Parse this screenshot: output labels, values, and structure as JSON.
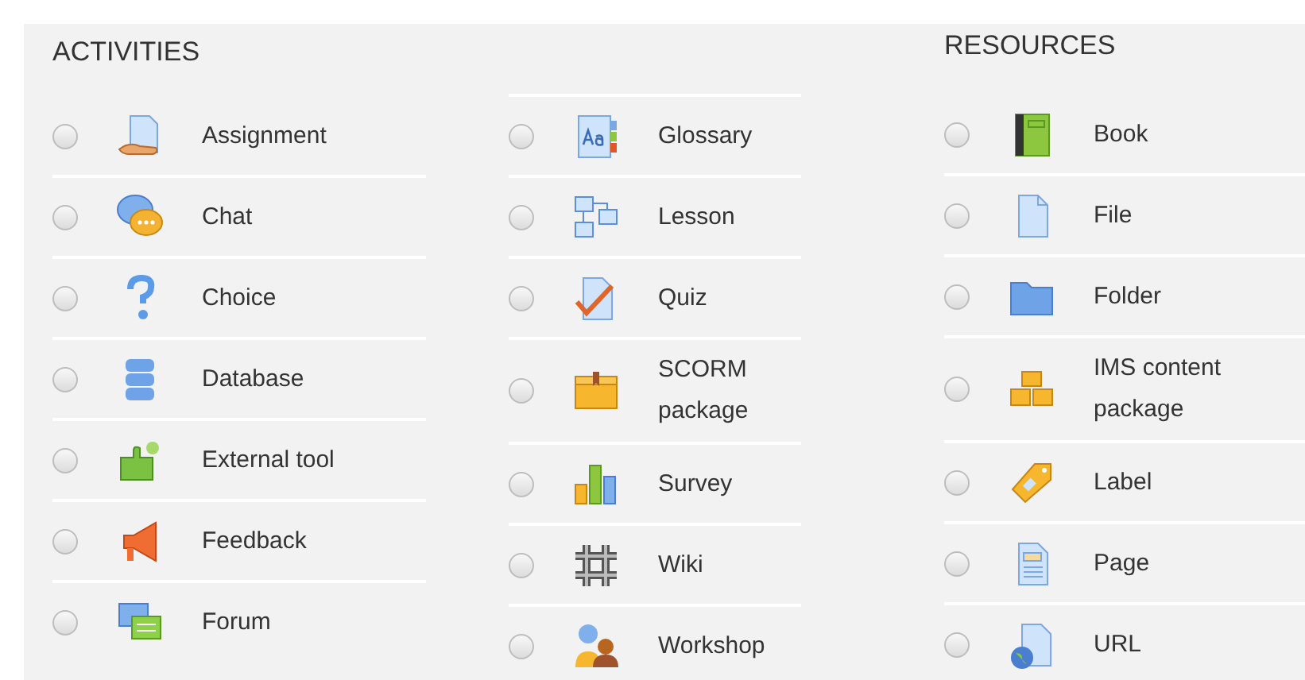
{
  "activities": {
    "heading": "ACTIVITIES",
    "columns": [
      [
        {
          "label": "Assignment",
          "selected": false
        },
        {
          "label": "Chat",
          "selected": false
        },
        {
          "label": "Choice",
          "selected": false
        },
        {
          "label": "Database",
          "selected": false
        },
        {
          "label": "External tool",
          "selected": false
        },
        {
          "label": "Feedback",
          "selected": false
        },
        {
          "label": "Forum",
          "selected": false
        }
      ],
      [
        {
          "label": "Glossary",
          "selected": false
        },
        {
          "label": "Lesson",
          "selected": false
        },
        {
          "label": "Quiz",
          "selected": false
        },
        {
          "label": "SCORM package",
          "selected": false
        },
        {
          "label": "Survey",
          "selected": false
        },
        {
          "label": "Wiki",
          "selected": false
        },
        {
          "label": "Workshop",
          "selected": false
        }
      ]
    ]
  },
  "resources": {
    "heading": "RESOURCES",
    "items": [
      {
        "label": "Book",
        "selected": false
      },
      {
        "label": "File",
        "selected": false
      },
      {
        "label": "Folder",
        "selected": false
      },
      {
        "label": "IMS content package",
        "selected": false
      },
      {
        "label": "Label",
        "selected": false
      },
      {
        "label": "Page",
        "selected": false
      },
      {
        "label": "URL",
        "selected": false
      }
    ]
  }
}
